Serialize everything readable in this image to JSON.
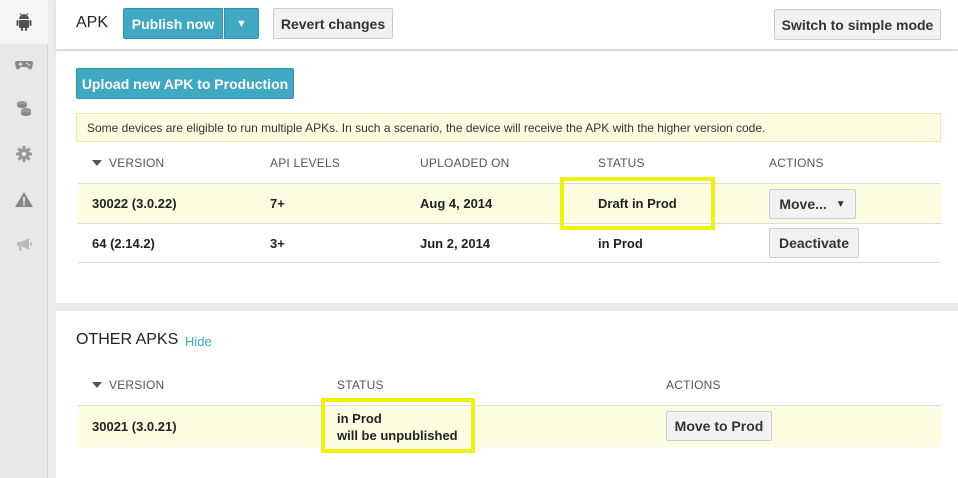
{
  "sidebar": {
    "icons": [
      "android-icon",
      "gamepad-icon",
      "coins-icon",
      "gear-icon",
      "warning-icon",
      "megaphone-icon"
    ]
  },
  "header": {
    "title": "APK",
    "publish_label": "Publish now",
    "publish_dropdown": "▼",
    "revert_label": "Revert changes",
    "simple_mode_label": "Switch to simple mode"
  },
  "upload": {
    "label": "Upload new APK to Production"
  },
  "banner": {
    "text": "Some devices are eligible to run multiple APKs. In such a scenario, the device will receive the APK with the higher version code."
  },
  "apk_table": {
    "columns": [
      "VERSION",
      "API LEVELS",
      "UPLOADED ON",
      "STATUS",
      "ACTIONS"
    ],
    "rows": [
      {
        "version": "30022 (3.0.22)",
        "api": "7+",
        "uploaded": "Aug 4, 2014",
        "status": "Draft in Prod",
        "action": "Move...",
        "action_caret": "▼"
      },
      {
        "version": "64 (2.14.2)",
        "api": "3+",
        "uploaded": "Jun 2, 2014",
        "status": "in Prod",
        "action": "Deactivate"
      }
    ]
  },
  "other_apks": {
    "title": "OTHER APKS",
    "hide_label": "Hide",
    "columns": [
      "VERSION",
      "STATUS",
      "ACTIONS"
    ],
    "rows": [
      {
        "version": "30021 (3.0.21)",
        "status_line1": "in Prod",
        "status_line2": "will be unpublished",
        "action": "Move to Prod"
      }
    ]
  },
  "colors": {
    "accent": "#3fa8c2",
    "highlight_row": "#fdfde1",
    "annotation_box": "#f0f20c"
  }
}
